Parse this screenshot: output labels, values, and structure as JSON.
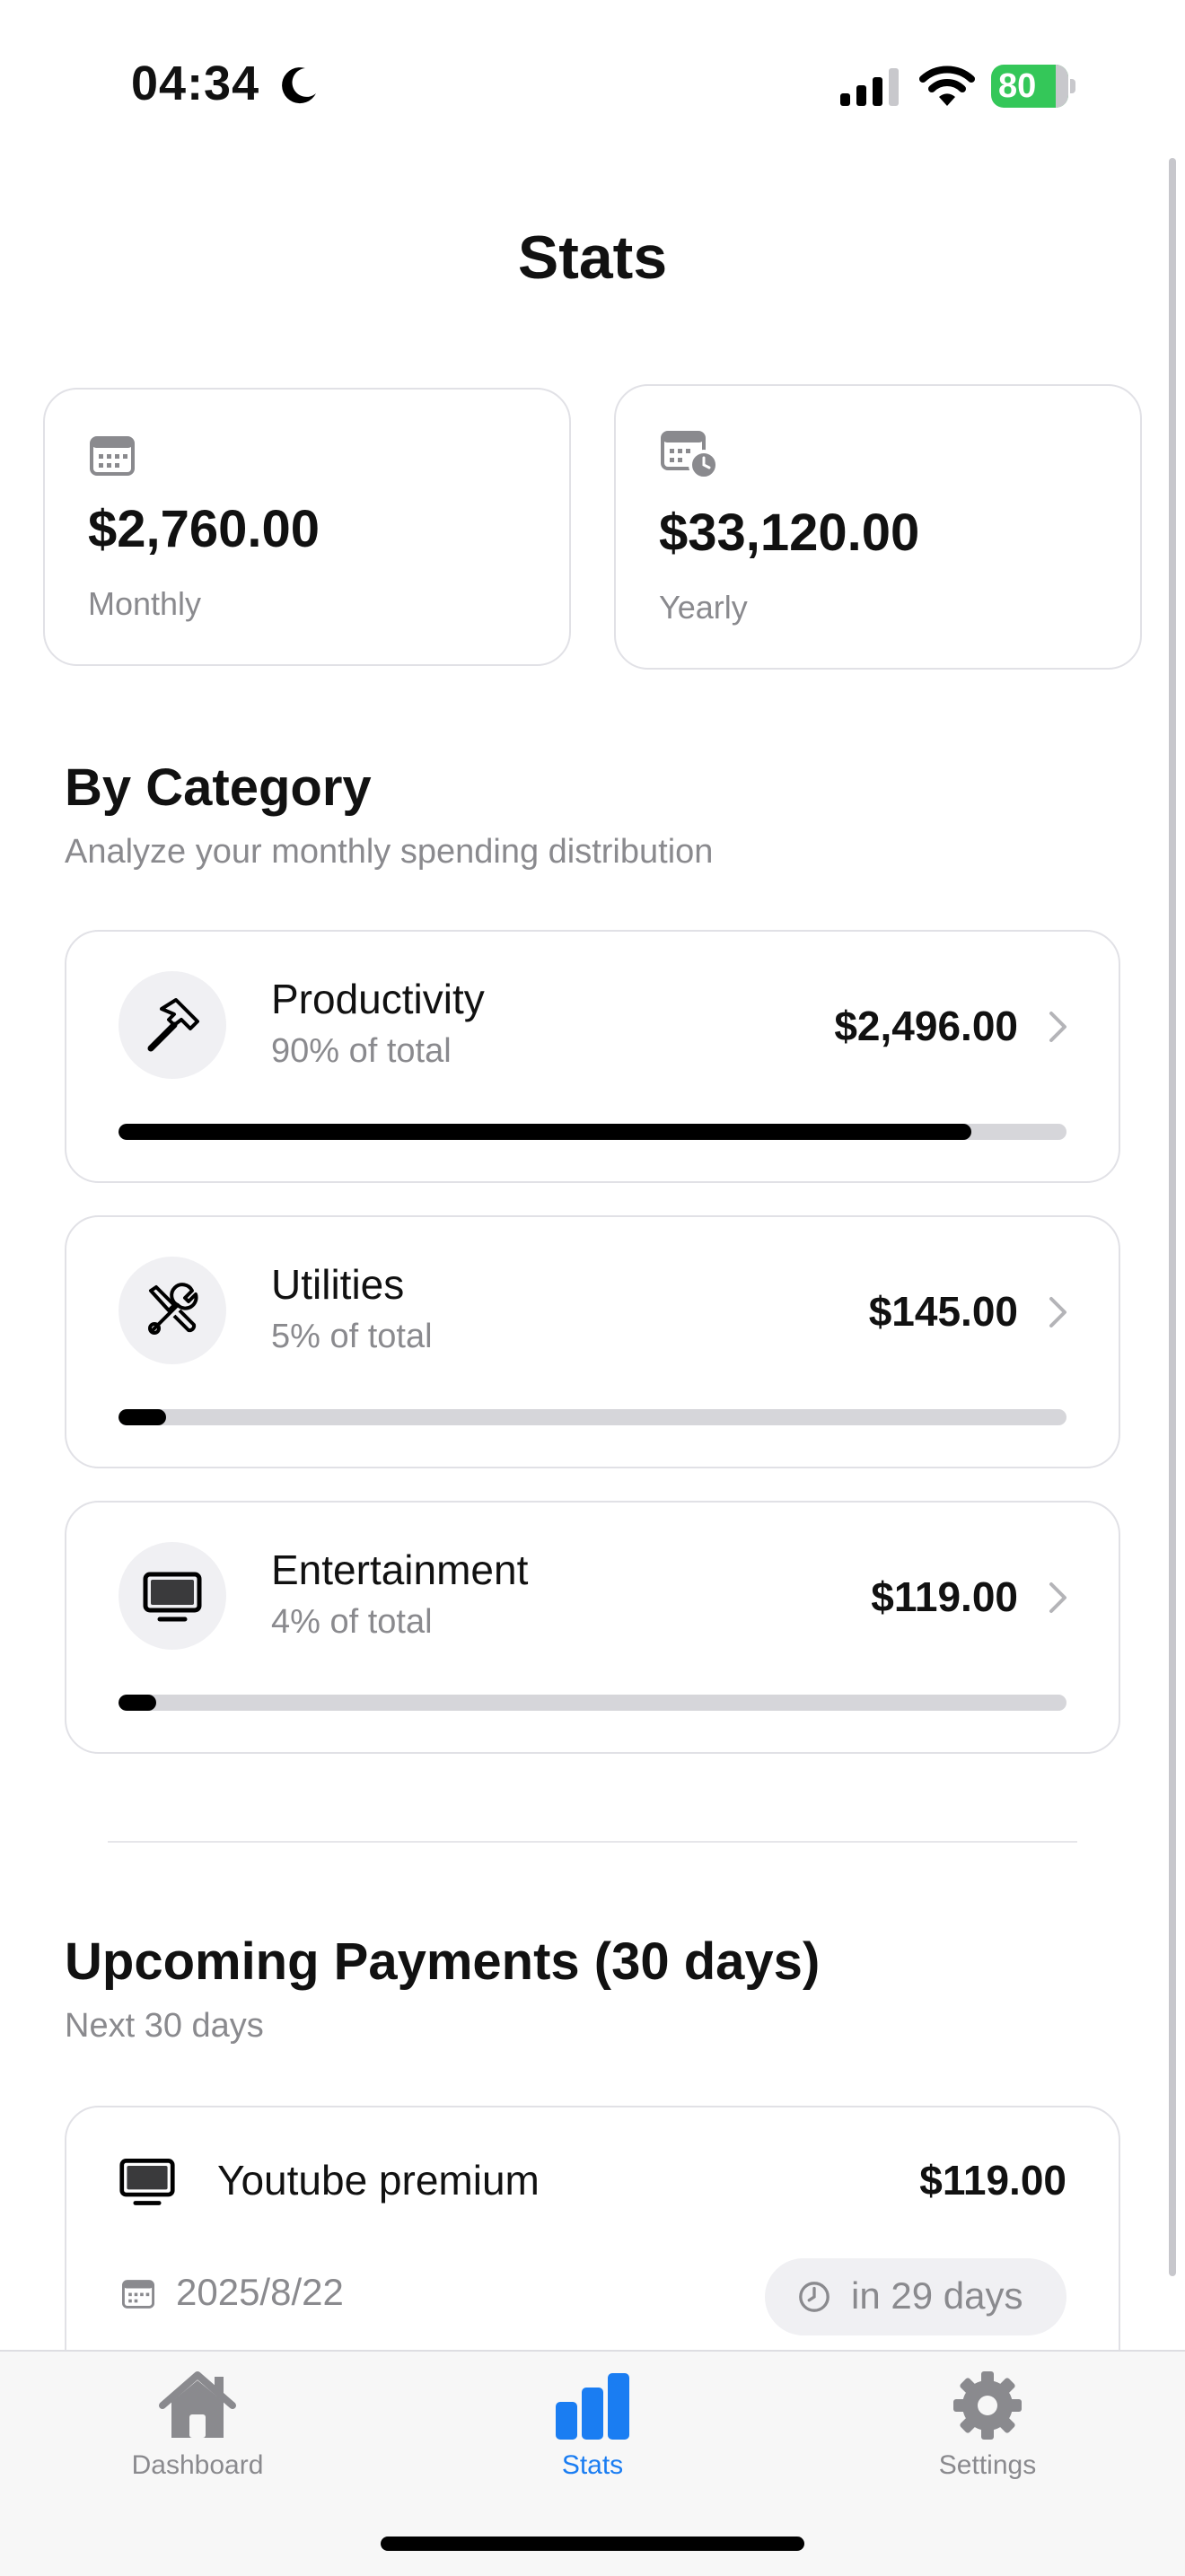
{
  "status_bar": {
    "time": "04:34",
    "battery": "80"
  },
  "header": {
    "title": "Stats"
  },
  "summary": [
    {
      "amount": "$2,760.00",
      "label": "Monthly",
      "icon": "calendar-icon"
    },
    {
      "amount": "$33,120.00",
      "label": "Yearly",
      "icon": "calendar-clock-icon"
    }
  ],
  "by_category": {
    "title": "By Category",
    "subtitle": "Analyze your monthly spending distribution",
    "items": [
      {
        "name": "Productivity",
        "percent_text": "90% of total",
        "amount": "$2,496.00",
        "progress": 0.9,
        "icon": "hammer-icon"
      },
      {
        "name": "Utilities",
        "percent_text": "5% of total",
        "amount": "$145.00",
        "progress": 0.05,
        "icon": "tools-icon"
      },
      {
        "name": "Entertainment",
        "percent_text": "4% of total",
        "amount": "$119.00",
        "progress": 0.04,
        "icon": "tv-icon"
      }
    ]
  },
  "upcoming": {
    "title": "Upcoming Payments (30 days)",
    "subtitle": "Next 30 days",
    "items": [
      {
        "name": "Youtube premium",
        "amount": "$119.00",
        "date": "2025/8/22",
        "due": "in 29 days",
        "icon": "tv-icon"
      }
    ]
  },
  "tabbar": {
    "tabs": [
      {
        "label": "Dashboard",
        "icon": "house-icon",
        "active": false
      },
      {
        "label": "Stats",
        "icon": "chart-bar-icon",
        "active": true
      },
      {
        "label": "Settings",
        "icon": "gear-icon",
        "active": false
      }
    ]
  },
  "colors": {
    "accent": "#1a7df2",
    "battery": "#34c759",
    "progress_fill": "#000000",
    "progress_track": "#d6d6da"
  }
}
